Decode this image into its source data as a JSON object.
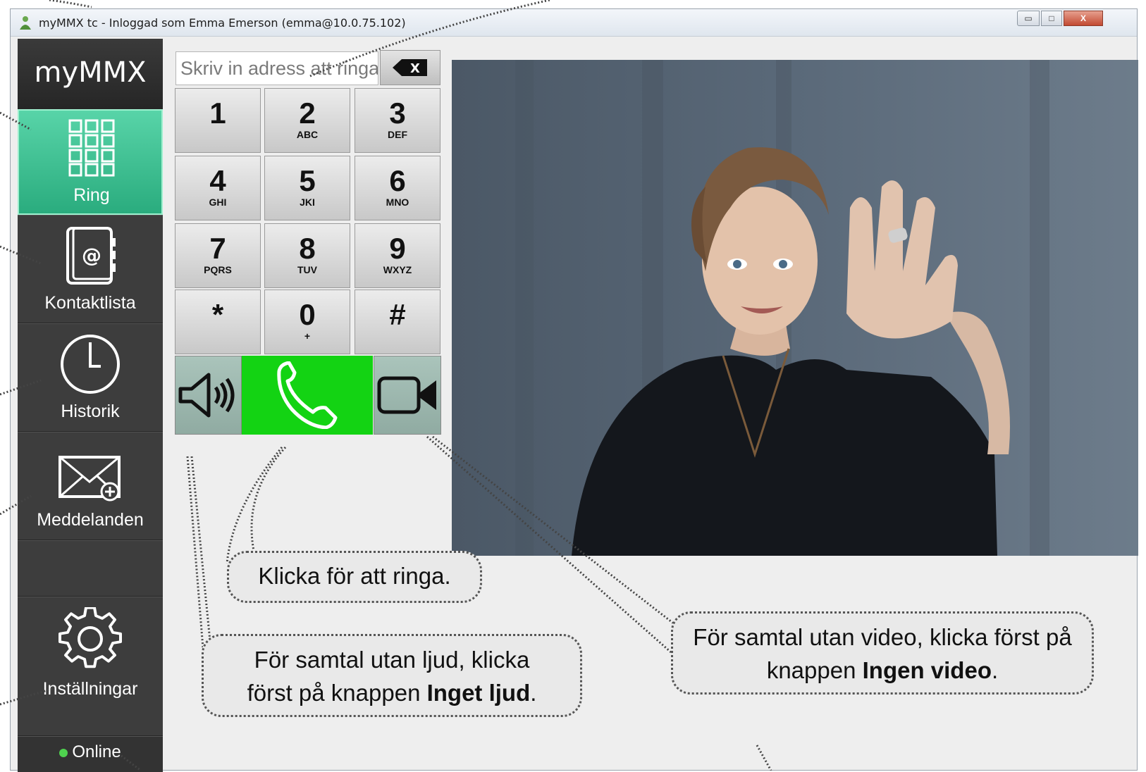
{
  "window": {
    "title": "myMMX tc - Inloggad som Emma Emerson (emma@10.0.75.102)",
    "min_label": "▭",
    "max_label": "□",
    "close_label": "X"
  },
  "sidebar": {
    "logo": "myMMX",
    "items": [
      {
        "label": "Ring",
        "icon": "dialpad-icon",
        "active": true
      },
      {
        "label": "Kontaktlista",
        "icon": "address-book-icon"
      },
      {
        "label": "Historik",
        "icon": "clock-icon"
      },
      {
        "label": "Meddelanden",
        "icon": "envelope-plus-icon"
      },
      {
        "label": "Inställningar",
        "icon": "gear-icon"
      }
    ],
    "status": "Online",
    "status_color": "#4fd24f"
  },
  "dialer": {
    "address_placeholder": "Skriv in adress att ringa",
    "backspace_label": "X",
    "keys": [
      {
        "digit": "1",
        "sub": ""
      },
      {
        "digit": "2",
        "sub": "ABC"
      },
      {
        "digit": "3",
        "sub": "DEF"
      },
      {
        "digit": "4",
        "sub": "GHI"
      },
      {
        "digit": "5",
        "sub": "JKI"
      },
      {
        "digit": "6",
        "sub": "MNO"
      },
      {
        "digit": "7",
        "sub": "PQRS"
      },
      {
        "digit": "8",
        "sub": "TUV"
      },
      {
        "digit": "9",
        "sub": "WXYZ"
      },
      {
        "digit": "*",
        "sub": ""
      },
      {
        "digit": "0",
        "sub": "+"
      },
      {
        "digit": "#",
        "sub": ""
      }
    ],
    "call_color": "#13d313"
  },
  "callouts": {
    "call": "Klicka för att ringa.",
    "audio_line1": "För samtal utan ljud, klicka",
    "audio_line2_pre": "först på knappen ",
    "audio_bold": "Inget ljud",
    "audio_post": ".",
    "video_line1": "För samtal utan video, klicka först på",
    "video_line2_pre": "knappen ",
    "video_bold": "Ingen video",
    "video_post": "."
  }
}
